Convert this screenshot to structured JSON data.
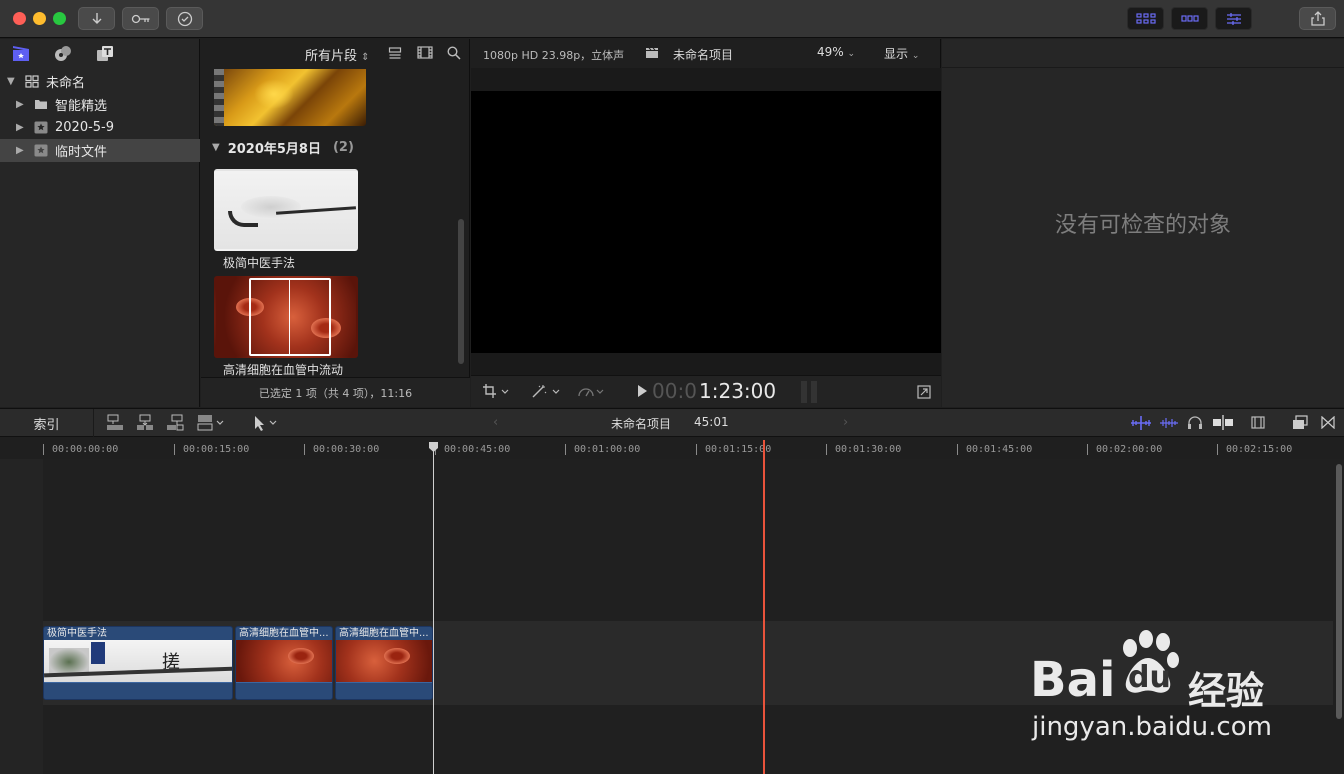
{
  "window": {
    "lights": {
      "close": "#fe5f57",
      "minimize": "#febc2e",
      "zoom": "#28c840"
    },
    "toolbar_icons": [
      "import-icon",
      "keyword-icon",
      "background-tasks-icon"
    ],
    "workspace_icons": [
      "browser-layout-icon",
      "timeline-layout-icon",
      "inspector-layout-icon"
    ],
    "share_icon": "share-icon",
    "accent": "#6a6cf5"
  },
  "library": {
    "tabs": [
      "libraries-icon",
      "photos-audio-icon",
      "titles-generators-icon"
    ],
    "items": [
      {
        "label": "未命名",
        "expanded": true,
        "icon": "library-icon"
      },
      {
        "label": "智能精选",
        "icon": "folder-icon"
      },
      {
        "label": "2020-5-9",
        "icon": "event-icon"
      },
      {
        "label": "临时文件",
        "icon": "event-icon",
        "selected": true
      }
    ]
  },
  "browser": {
    "filter": "所有片段",
    "date_group": "2020年5月8日",
    "date_count": "(2)",
    "clips": [
      {
        "name": "极简中医手法"
      },
      {
        "name": "高清细胞在血管中流动"
      }
    ],
    "status": "已选定 1 项（共 4 项），11:16"
  },
  "viewer": {
    "format": "1080p HD 23.98p，立体声",
    "project": "未命名项目",
    "zoom": "49%",
    "display": "显示",
    "timecode_dim": "00:0",
    "timecode": "1:23:00"
  },
  "inspector": {
    "empty_text": "没有可检查的对象"
  },
  "timeline": {
    "index_label": "索引",
    "project_name": "未命名项目",
    "duration": "45:01",
    "ruler": [
      "00:00:00:00",
      "00:00:15:00",
      "00:00:30:00",
      "00:00:45:00",
      "00:01:00:00",
      "00:01:15:00",
      "00:01:30:00",
      "00:01:45:00",
      "00:02:00:00",
      "00:02:15:00"
    ],
    "clips": [
      {
        "name": "极简中医手法"
      },
      {
        "name": "高清细胞在血管中..."
      },
      {
        "name": "高清细胞在血管中..."
      }
    ],
    "playhead_color": "#e8533b"
  },
  "watermark": {
    "brand_text": "Bai",
    "brand_du": "du",
    "brand_cn": "经验",
    "url": "jingyan.baidu.com"
  }
}
